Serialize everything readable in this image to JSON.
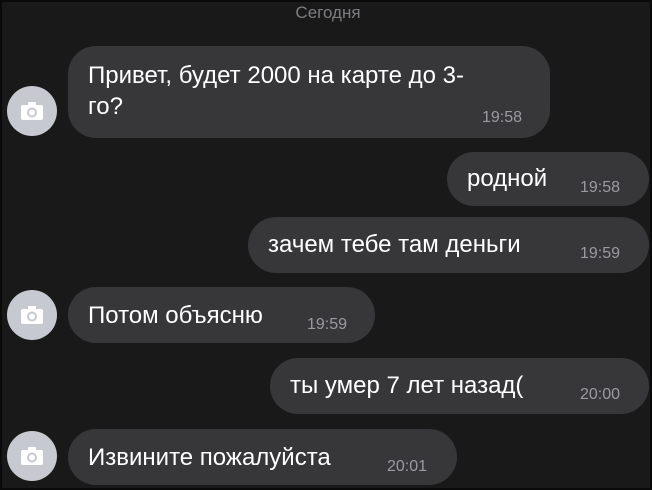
{
  "chat": {
    "date_header": "Сегодня",
    "messages": [
      {
        "direction": "incoming",
        "text_line1": "Привет, будет 2000 на карте до 3-",
        "text_line2": "го?",
        "time": "19:58",
        "avatar_icon": "camera-icon"
      },
      {
        "direction": "outgoing",
        "text": "родной",
        "time": "19:58"
      },
      {
        "direction": "outgoing",
        "text": "зачем тебе там деньги",
        "time": "19:59"
      },
      {
        "direction": "incoming",
        "text": "Потом объясню",
        "time": "19:59",
        "avatar_icon": "camera-icon"
      },
      {
        "direction": "outgoing",
        "text": "ты умер 7 лет назад(",
        "time": "20:00"
      },
      {
        "direction": "incoming",
        "text": "Извините пожалуйста",
        "time": "20:01",
        "avatar_icon": "camera-icon"
      }
    ]
  },
  "colors": {
    "background": "#19191a",
    "bubble": "#37373a",
    "message_text": "#ffffff",
    "timestamp": "#9a9b9f",
    "date_header": "#7c7d80",
    "avatar_placeholder": "#c6c9cf"
  }
}
